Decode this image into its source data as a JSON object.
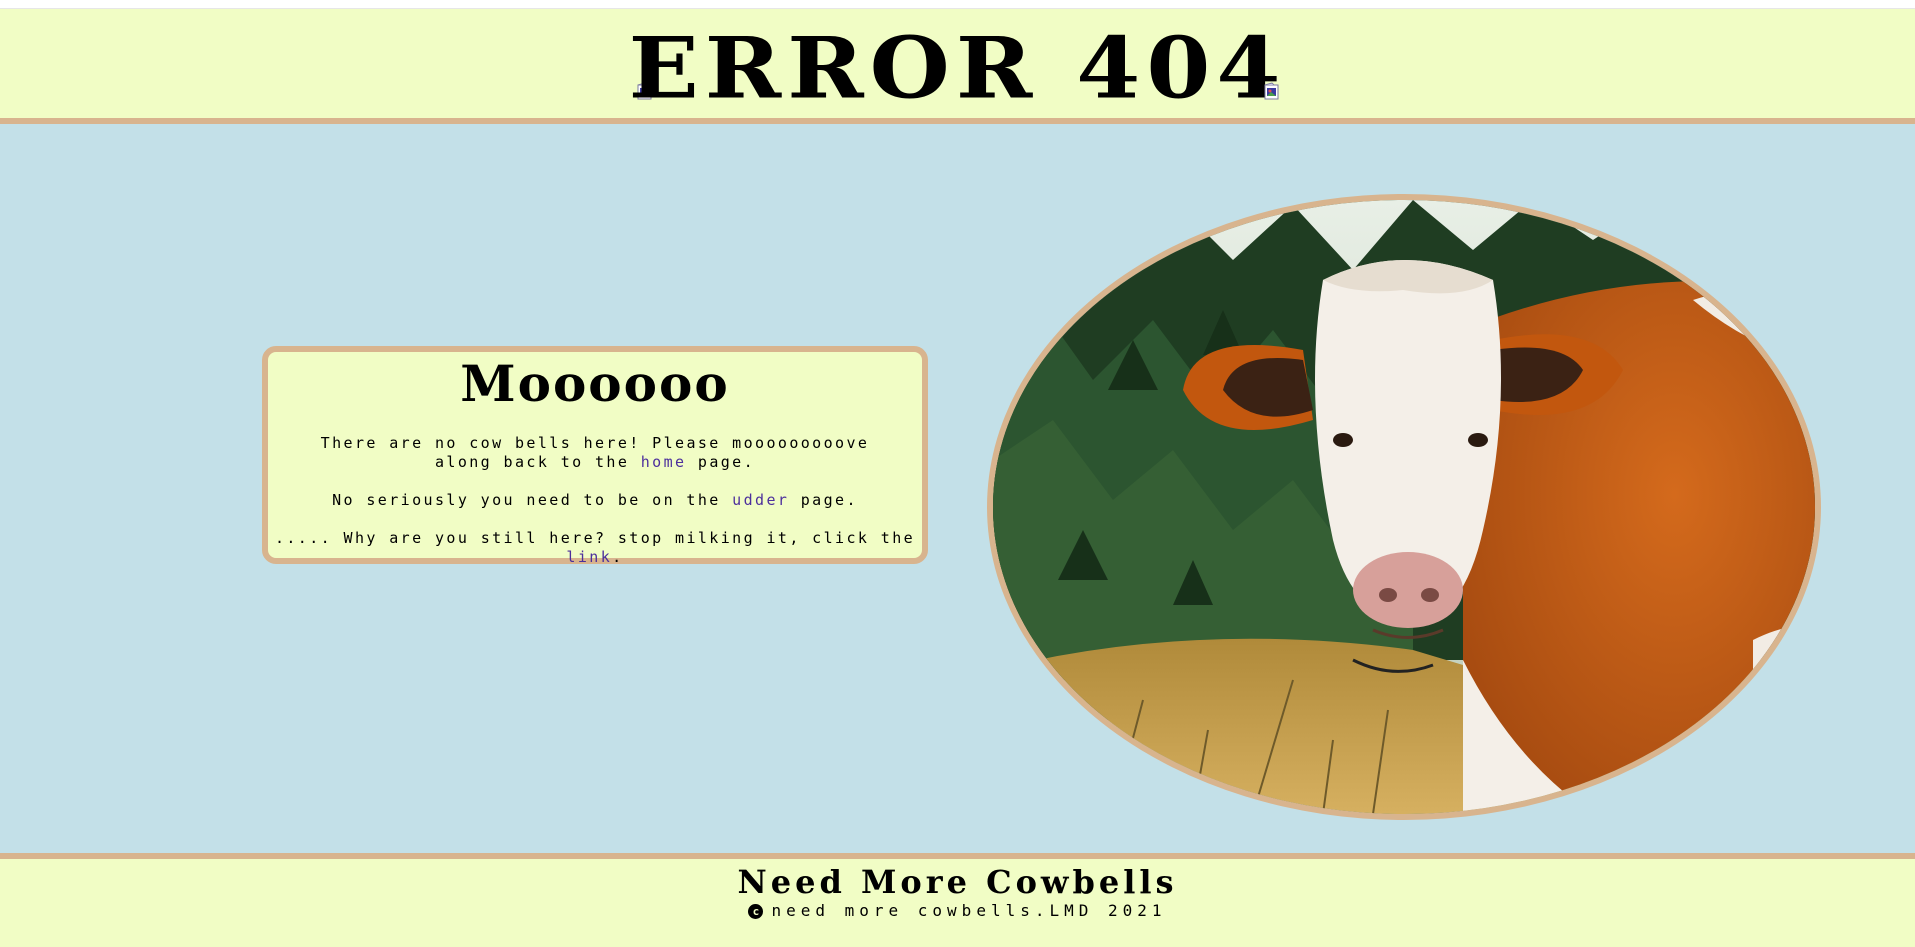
{
  "header": {
    "title": "ERROR 404"
  },
  "card": {
    "title": "Moooooo",
    "line1_before": "There are no cow bells here! Please mooooooooove along back to the ",
    "line1_link": "home",
    "line1_after": " page.",
    "line2_before": "No seriously you need to be on the ",
    "line2_link": "udder",
    "line2_after": " page.",
    "line3_before": "..... Why are you still here? stop milking it, click the ",
    "line3_link": "link",
    "line3_after": "."
  },
  "footer": {
    "title": "Need More Cowbells",
    "copyright_symbol": "c",
    "copyright_text": "need more cowbells.LMD 2021"
  },
  "icons": {
    "broken_image_left": "broken-image-icon",
    "broken_image_right": "broken-image-icon",
    "copyright": "copyright-icon"
  },
  "colors": {
    "header_bg": "#f1fdc5",
    "main_bg": "#c3e0e8",
    "accent_border": "#d8b48e",
    "link": "#4c2f9c"
  }
}
